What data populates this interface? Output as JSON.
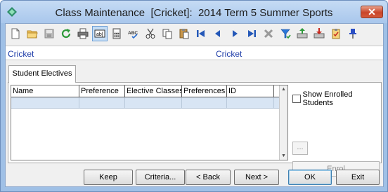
{
  "window": {
    "title": "Class Maintenance  [Cricket]:  2014 Term 5 Summer Sports",
    "close_label": "✕"
  },
  "toolbar": {
    "buttons": [
      {
        "icon": "new-document-icon"
      },
      {
        "icon": "open-folder-icon"
      },
      {
        "icon": "save-icon"
      },
      {
        "icon": "refresh-icon"
      },
      {
        "icon": "print-icon"
      },
      {
        "icon": "form-field-icon",
        "label": "ab|"
      },
      {
        "icon": "calculator-icon"
      },
      {
        "icon": "spell-check-icon",
        "label": "ABC"
      },
      {
        "icon": "cut-icon"
      },
      {
        "icon": "copy-icon"
      },
      {
        "icon": "paste-icon"
      },
      {
        "icon": "first-record-icon"
      },
      {
        "icon": "previous-record-icon"
      },
      {
        "icon": "next-record-icon"
      },
      {
        "icon": "last-record-icon"
      },
      {
        "icon": "delete-icon"
      },
      {
        "icon": "filter-icon"
      },
      {
        "icon": "export-icon"
      },
      {
        "icon": "import-icon"
      },
      {
        "icon": "checklist-icon"
      },
      {
        "icon": "pin-icon"
      }
    ]
  },
  "info_bar": {
    "left_text": "Cricket",
    "right_text": "Cricket"
  },
  "tabs": [
    {
      "label": "Student Electives"
    }
  ],
  "grid": {
    "columns": [
      "Name",
      "Preference",
      "Elective Classes",
      "Preferences",
      "ID"
    ],
    "rows": [
      [
        "",
        "",
        "",
        "",
        ""
      ]
    ]
  },
  "options": {
    "show_enrolled_label": "Show Enrolled Students",
    "show_enrolled_checked": false,
    "ellipsis_label": "...",
    "enrol_label": "Enrol"
  },
  "footer": {
    "keep_label": "Keep",
    "criteria_label": "Criteria...",
    "back_label": "< Back",
    "next_label": "Next >",
    "ok_label": "OK",
    "exit_label": "Exit"
  },
  "colors": {
    "title_bar": "#b7d2f1",
    "info_text": "#1e3ca8",
    "grid_selected_row": "#d8e5f4"
  }
}
